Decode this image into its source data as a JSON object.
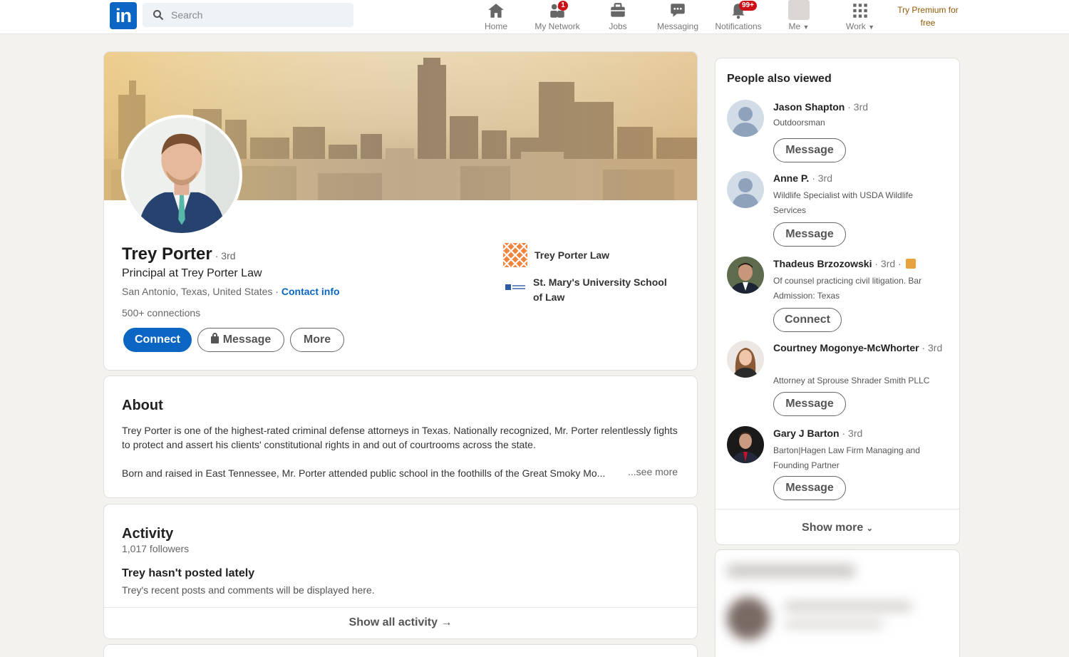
{
  "nav": {
    "logo_text": "in",
    "search_placeholder": "Search",
    "items": [
      {
        "label": "Home",
        "icon": "home-icon"
      },
      {
        "label": "My Network",
        "icon": "network-icon",
        "badge": "1"
      },
      {
        "label": "Jobs",
        "icon": "jobs-icon"
      },
      {
        "label": "Messaging",
        "icon": "messaging-icon"
      },
      {
        "label": "Notifications",
        "icon": "bell-icon",
        "badge": "99+"
      },
      {
        "label": "Me",
        "icon": "avatar"
      },
      {
        "label": "Work",
        "icon": "grid-icon"
      }
    ],
    "premium": "Try Premium for free"
  },
  "profile": {
    "name": "Trey Porter",
    "degree": "· 3rd",
    "headline": "Principal at Trey Porter Law",
    "location": "San Antonio, Texas, United States ·",
    "contact_info": "Contact info",
    "connections": "500+ connections",
    "buttons": {
      "connect": "Connect",
      "message": "Message",
      "more": "More"
    },
    "experience": [
      {
        "label": "Trey Porter Law"
      },
      {
        "label": "St. Mary's University School of Law"
      }
    ]
  },
  "about": {
    "title": "About",
    "paragraph1": "Trey Porter is one of the highest-rated criminal defense attorneys in Texas. Nationally recognized, Mr. Porter relentlessly fights to protect and assert his clients' constitutional rights in and out of courtrooms across the state.",
    "paragraph2": "Born and raised in East Tennessee, Mr. Porter attended public school in the foothills of the Great Smoky Mo...",
    "see_more": "...see more"
  },
  "activity": {
    "title": "Activity",
    "followers": "1,017 followers",
    "empty_title": "Trey hasn't posted lately",
    "empty_text": "Trey's recent posts and comments will be displayed here.",
    "show_all": "Show all activity →"
  },
  "people_also_viewed": {
    "title": "People also viewed",
    "people": [
      {
        "name": "Jason Shapton",
        "degree": "· 3rd",
        "headline": "Outdoorsman",
        "button": "Message"
      },
      {
        "name": "Anne P.",
        "degree": "· 3rd",
        "headline": "Wildlife Specialist with USDA Wildlife Services",
        "button": "Message"
      },
      {
        "name": "Thadeus Brzozowski",
        "degree": "· 3rd ·",
        "headline": "Of counsel practicing civil litigation. Bar Admission: Texas",
        "button": "Connect"
      },
      {
        "name": "Courtney Mogonye-McWhorter",
        "degree": "· 3rd",
        "headline": "Attorney at Sprouse Shrader Smith PLLC",
        "button": "Message"
      },
      {
        "name": "Gary J Barton",
        "degree": "· 3rd",
        "headline": "Barton|Hagen Law Firm Managing and Founding Partner",
        "button": "Message"
      }
    ],
    "show_more": "Show more"
  },
  "colors": {
    "brand": "#0a66c2",
    "background": "#f3f2ef",
    "badge": "#cc1016",
    "premium": "#915907"
  }
}
